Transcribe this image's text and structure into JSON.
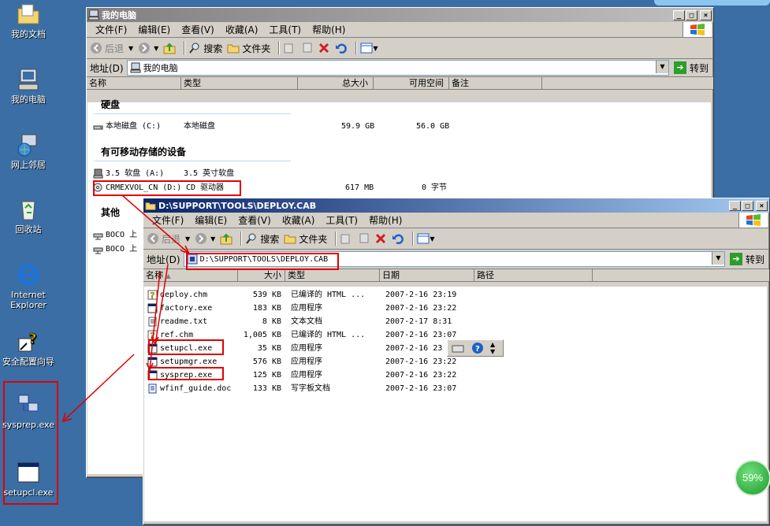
{
  "desktop": {
    "icons": [
      {
        "label": "我的文档",
        "icon": "folder-documents-icon"
      },
      {
        "label": "我的电脑",
        "icon": "computer-icon"
      },
      {
        "label": "网上邻居",
        "icon": "network-icon"
      },
      {
        "label": "回收站",
        "icon": "recycle-bin-icon"
      },
      {
        "label": "Internet Explorer",
        "icon": "internet-explorer-icon"
      },
      {
        "label": "安全配置向导",
        "icon": "security-wizard-icon"
      },
      {
        "label": "sysprep.exe",
        "icon": "sysprep-icon"
      },
      {
        "label": "setupcl.exe",
        "icon": "window-app-icon"
      }
    ],
    "progress_badge": "59%",
    "highlight_color": "#e00000"
  },
  "window_mycomputer": {
    "title": "我的电脑",
    "menu": [
      "文件(F)",
      "编辑(E)",
      "查看(V)",
      "收藏(A)",
      "工具(T)",
      "帮助(H)"
    ],
    "toolbar": {
      "back": "后退",
      "search": "搜索",
      "folders": "文件夹"
    },
    "address_label": "地址(D)",
    "address_value": "我的电脑",
    "go_label": "转到",
    "columns": [
      "名称",
      "类型",
      "总大小",
      "可用空间",
      "备注"
    ],
    "groups": {
      "hard_disks": "硬盘",
      "removable": "有可移动存储的设备",
      "other": "其他"
    },
    "drives": [
      {
        "name": "本地磁盘 (C:)",
        "type": "本地磁盘",
        "total": "59.9 GB",
        "free": "56.0 GB"
      },
      {
        "name": "3.5 软盘 (A:)",
        "type": "3.5 英寸软盘",
        "total": "",
        "free": ""
      },
      {
        "name": "CRMEXVOL_CN (D:)",
        "type": "CD 驱动器",
        "total": "617 MB",
        "free": "0 字节"
      }
    ],
    "other_items": [
      "BOCO 上",
      "BOCO 上"
    ]
  },
  "window_deploy": {
    "title": "D:\\SUPPORT\\TOOLS\\DEPLOY.CAB",
    "menu": [
      "文件(F)",
      "编辑(E)",
      "查看(V)",
      "收藏(A)",
      "工具(T)",
      "帮助(H)"
    ],
    "toolbar": {
      "back": "后退",
      "search": "搜索",
      "folders": "文件夹"
    },
    "address_label": "地址(D)",
    "address_value": "D:\\SUPPORT\\TOOLS\\DEPLOY.CAB",
    "go_label": "转到",
    "columns": [
      "名称",
      "大小",
      "类型",
      "日期",
      "路径"
    ],
    "files": [
      {
        "name": "deploy.chm",
        "size": "539 KB",
        "type": "已编译的 HTML ...",
        "date": "2007-2-16 23:19",
        "icon": "help-file-icon"
      },
      {
        "name": "factory.exe",
        "size": "183 KB",
        "type": "应用程序",
        "date": "2007-2-16 23:22",
        "icon": "window-app-icon"
      },
      {
        "name": "readme.txt",
        "size": "8 KB",
        "type": "文本文档",
        "date": "2007-2-17 8:31",
        "icon": "text-file-icon"
      },
      {
        "name": "ref.chm",
        "size": "1,005 KB",
        "type": "已编译的 HTML ...",
        "date": "2007-2-16 23:07",
        "icon": "help-file-icon"
      },
      {
        "name": "setupcl.exe",
        "size": "35 KB",
        "type": "应用程序",
        "date": "2007-2-16 23",
        "icon": "window-app-icon"
      },
      {
        "name": "setupmgr.exe",
        "size": "576 KB",
        "type": "应用程序",
        "date": "2007-2-16 23:22",
        "icon": "window-app-icon"
      },
      {
        "name": "sysprep.exe",
        "size": "125 KB",
        "type": "应用程序",
        "date": "2007-2-16 23:22",
        "icon": "window-app-icon"
      },
      {
        "name": "wfinf_guide.doc",
        "size": "133 KB",
        "type": "写字板文档",
        "date": "2007-2-16 23:07",
        "icon": "document-icon"
      }
    ]
  }
}
